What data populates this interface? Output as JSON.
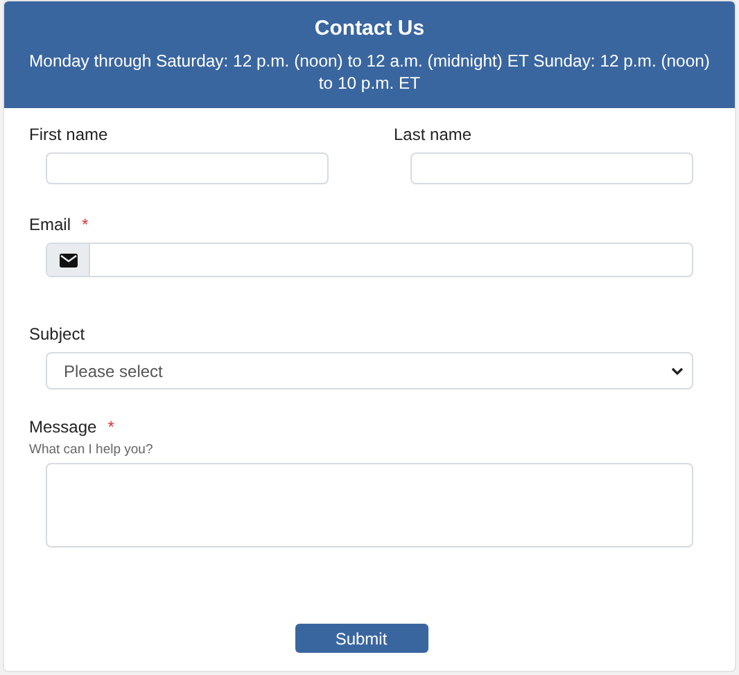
{
  "header": {
    "title": "Contact Us",
    "hours": "Monday through Saturday: 12 p.m. (noon) to 12 a.m. (midnight) ET Sunday: 12 p.m. (noon) to 10 p.m. ET"
  },
  "name_fields": [
    {
      "label": "First name"
    },
    {
      "label": "Last name"
    }
  ],
  "email": {
    "label": "Email",
    "required_mark": "*"
  },
  "subject": {
    "label": "Subject",
    "value": "Please select"
  },
  "message": {
    "label": "Message",
    "required_mark": "*",
    "hint": "What can I help you?"
  },
  "submit": {
    "label": "Submit"
  }
}
